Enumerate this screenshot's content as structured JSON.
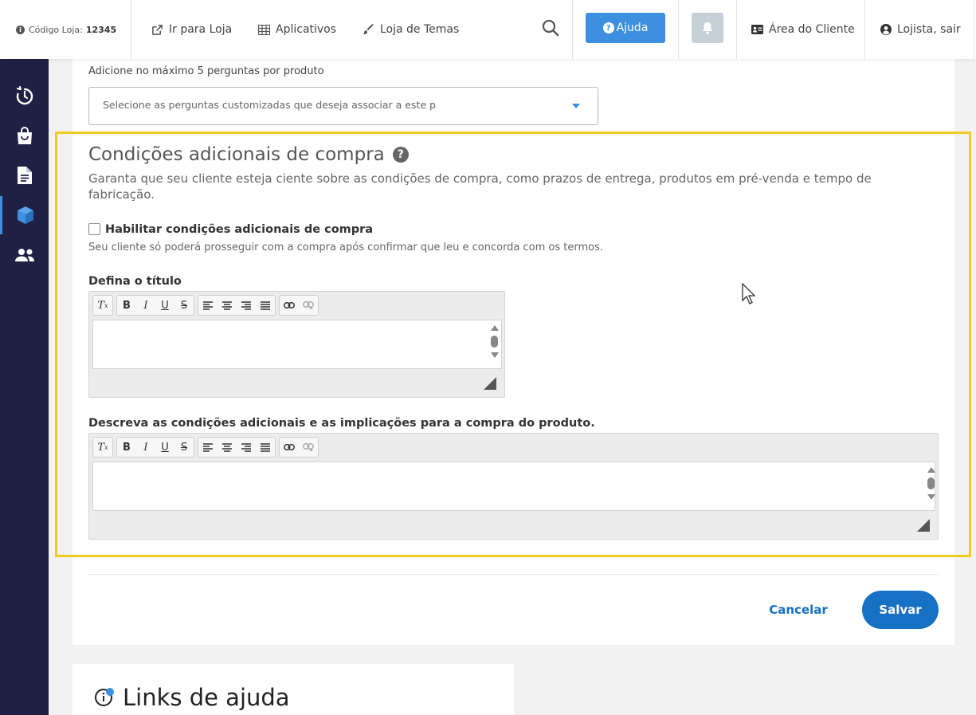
{
  "topbar": {
    "store_code_label": "Código Loja:",
    "store_code": "12345",
    "go_to_store": "Ir para Loja",
    "apps": "Aplicativos",
    "theme_store": "Loja de Temas",
    "help": "Ajuda",
    "client_area": "Área do Cliente",
    "logout": "Lojista, sair",
    "accent_color": "#3d8fe0"
  },
  "sidebar": {
    "items": [
      {
        "icon": "timer-icon"
      },
      {
        "icon": "shopping-bag-icon"
      },
      {
        "icon": "document-icon"
      },
      {
        "icon": "box-icon",
        "active": true
      },
      {
        "icon": "users-icon"
      }
    ],
    "bg_color": "#1f2044"
  },
  "questions": {
    "label": "Adicione no máximo 5 perguntas por produto",
    "placeholder": "Selecione as perguntas customizadas que deseja associar a este p"
  },
  "conditions": {
    "title": "Condições adicionais de compra",
    "description": "Garanta que seu cliente esteja ciente sobre as condições de compra, como prazos de entrega, produtos em pré-venda e tempo de fabricação.",
    "enable_label": "Habilitar condições adicionais de compra",
    "enable_checked": false,
    "enable_hint": "Seu cliente só poderá prosseguir com a compra após confirmar que leu e concorda com os termos.",
    "title_field_label": "Defina o título",
    "description_field_label": "Descreva as condições adicionais e as implicações para a compra do produto.",
    "title_field_value": "",
    "description_field_value": "",
    "highlight_color": "#f0cc1e"
  },
  "actions": {
    "cancel": "Cancelar",
    "save": "Salvar",
    "primary_color": "#1670c4"
  },
  "help_links": {
    "title": "Links de ajuda"
  }
}
